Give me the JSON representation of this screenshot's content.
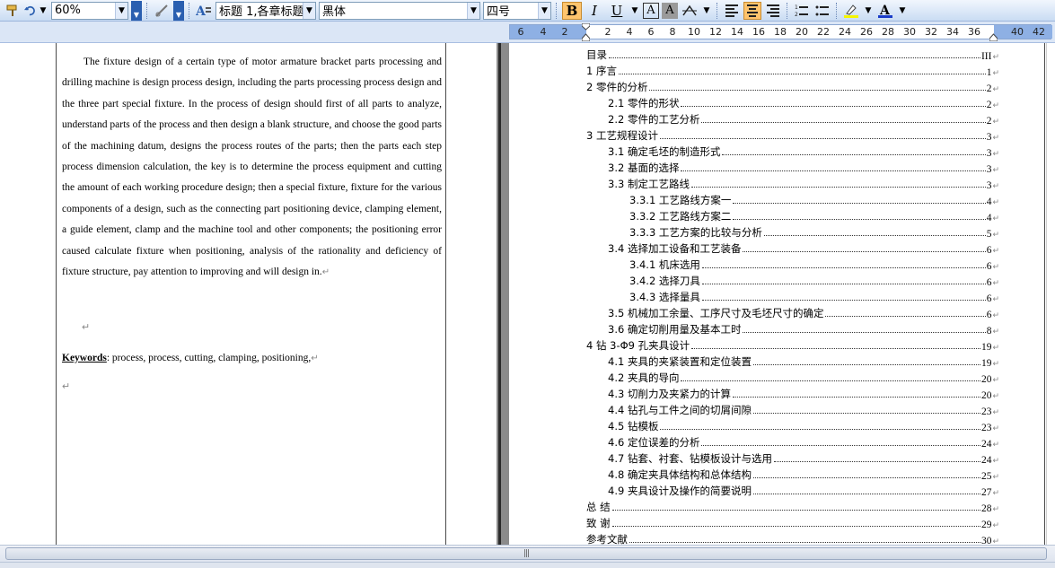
{
  "toolbar": {
    "zoom": "60%",
    "style": "标题 1,各章标题",
    "font": "黑体",
    "size": "四号",
    "bold_label": "B",
    "italic_label": "I",
    "underline_label": "U",
    "char_border_label": "A",
    "char_shading_label": "A",
    "font_color_label": "A",
    "accent_color": "#ffc46d",
    "icons": [
      "format-painter-icon",
      "undo-icon",
      "insert-hyperlink-icon",
      "styles-pane-icon",
      "highlight-icon"
    ]
  },
  "ruler": {
    "ticks": [
      "6",
      "4",
      "2",
      "2",
      "4",
      "6",
      "8",
      "10",
      "12",
      "14",
      "16",
      "18",
      "20",
      "22",
      "24",
      "26",
      "28",
      "30",
      "32",
      "34",
      "36",
      "40",
      "42"
    ]
  },
  "left_page": {
    "abstract": "The fixture design of a certain type of motor armature bracket parts processing and drilling machine is design process design, including the parts processing process design and the three part special fixture. In the process of design should first of all parts to analyze, understand parts of the process and then design a blank structure, and choose the good parts of the machining datum, designs the process routes of the parts; then the parts each step process dimension calculation, the key is to determine the process equipment and cutting the amount of each working procedure design; then a special fixture, fixture for the various components of a design, such as the connecting part positioning device, clamping element, a guide element, clamp and the machine tool and other components; the positioning error caused calculate fixture when positioning, analysis of the rationality and deficiency of fixture structure, pay attention to improving and will design in.",
    "paragraph_mark": "↵",
    "keywords_label": "Keywords",
    "keywords_text": ": process, process, cutting, clamping, positioning,"
  },
  "toc": [
    {
      "title": "目录",
      "page": "III",
      "level": 1
    },
    {
      "title": "1  序言",
      "page": "1",
      "level": 1
    },
    {
      "title": "2  零件的分析",
      "page": "2",
      "level": 1
    },
    {
      "title": "2.1 零件的形状",
      "page": "2",
      "level": 2
    },
    {
      "title": "2.2 零件的工艺分析",
      "page": "2",
      "level": 2
    },
    {
      "title": "3  工艺规程设计",
      "page": "3",
      "level": 1
    },
    {
      "title": "3.1  确定毛坯的制造形式",
      "page": "3",
      "level": 2
    },
    {
      "title": "3.2  基面的选择",
      "page": "3",
      "level": 2
    },
    {
      "title": "3.3  制定工艺路线",
      "page": "3",
      "level": 2
    },
    {
      "title": "3.3.1  工艺路线方案一",
      "page": "4",
      "level": 3
    },
    {
      "title": "3.3.2  工艺路线方案二",
      "page": "4",
      "level": 3
    },
    {
      "title": "3.3.3  工艺方案的比较与分析",
      "page": "5",
      "level": 3
    },
    {
      "title": "3.4  选择加工设备和工艺装备",
      "page": "6",
      "level": 2
    },
    {
      "title": "3.4.1  机床选用",
      "page": "6",
      "level": 3
    },
    {
      "title": "3.4.2  选择刀具",
      "page": "6",
      "level": 3
    },
    {
      "title": "3.4.3  选择量具",
      "page": "6",
      "level": 3
    },
    {
      "title": "3.5  机械加工余量、工序尺寸及毛坯尺寸的确定",
      "page": "6",
      "level": 2
    },
    {
      "title": "3.6 确定切削用量及基本工时",
      "page": "8",
      "level": 2
    },
    {
      "title": "4   钻 3-Φ9 孔夹具设计",
      "page": "19",
      "level": 1
    },
    {
      "title": "4.1  夹具的夹紧装置和定位装置",
      "page": "19",
      "level": 2
    },
    {
      "title": "4.2  夹具的导向",
      "page": "20",
      "level": 2
    },
    {
      "title": "4.3  切削力及夹紧力的计算",
      "page": "20",
      "level": 2
    },
    {
      "title": "4.4  钻孔与工件之间的切屑间隙",
      "page": "23",
      "level": 2
    },
    {
      "title": "4.5  钻模板",
      "page": "23",
      "level": 2
    },
    {
      "title": "4.6 定位误差的分析",
      "page": "24",
      "level": 2
    },
    {
      "title": "4.7  钻套、衬套、钻模板设计与选用",
      "page": "24",
      "level": 2
    },
    {
      "title": "4.8  确定夹具体结构和总体结构",
      "page": "25",
      "level": 2
    },
    {
      "title": "4.9  夹具设计及操作的简要说明",
      "page": "27",
      "level": 2
    },
    {
      "title": "总      结",
      "page": "28",
      "level": 1
    },
    {
      "title": "致      谢",
      "page": "29",
      "level": 1
    },
    {
      "title": "参考文献",
      "page": "30",
      "level": 1
    }
  ],
  "scrollbar": {
    "grip": "|||"
  }
}
